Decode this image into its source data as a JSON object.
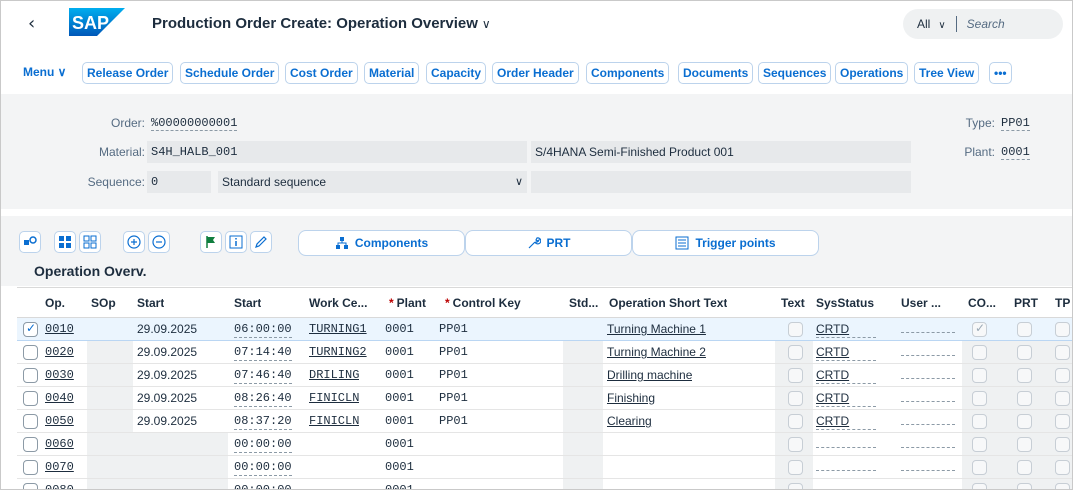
{
  "shell": {
    "back_glyph": "‹",
    "logo_text": "SAP",
    "title": "Production Order Create: Operation Overview",
    "title_chevron": "∨",
    "search_scope": "All",
    "search_scope_chevron": "∨",
    "search_placeholder": "Search"
  },
  "toolbar": {
    "menu": "Menu ∨",
    "items": [
      "Release Order",
      "Schedule Order",
      "Cost Order",
      "Material",
      "Capacity",
      "Order Header",
      "Components",
      "Documents",
      "Sequences",
      "Operations",
      "Tree View"
    ],
    "more": "•••"
  },
  "header": {
    "order_label": "Order:",
    "order_value": "%00000000001",
    "type_label": "Type:",
    "type_value": "PP01",
    "material_label": "Material:",
    "material_value": "S4H_HALB_001",
    "material_desc": "S/4HANA Semi-Finished Product 001",
    "plant_label": "Plant:",
    "plant_value": "0001",
    "sequence_label": "Sequence:",
    "sequence_value": "0",
    "sequence_desc": "Standard sequence",
    "sequence_chevron": "∨"
  },
  "grid_toolbar": {
    "components": "Components",
    "prt": "PRT",
    "trigger_points": "Trigger points"
  },
  "section_title": "Operation Overv.",
  "table": {
    "columns": {
      "op": "Op.",
      "sop": "SOp",
      "start_date": "Start",
      "start_time": "Start",
      "work_center": "Work Ce...",
      "plant": "Plant",
      "control_key": "Control Key",
      "std": "Std...",
      "short_text": "Operation Short Text",
      "text": "Text",
      "sys_status": "SysStatus",
      "user": "User ...",
      "co": "CO...",
      "prt": "PRT",
      "tp": "TP"
    },
    "required_marker": "*",
    "rows": [
      {
        "op": "0010",
        "date": "29.09.2025",
        "time": "06:00:00",
        "wc": "TURNING1",
        "plant": "0001",
        "ck": "PP01",
        "text": "Turning Machine 1",
        "status": "CRTD",
        "co": true
      },
      {
        "op": "0020",
        "date": "29.09.2025",
        "time": "07:14:40",
        "wc": "TURNING2",
        "plant": "0001",
        "ck": "PP01",
        "text": "Turning Machine 2",
        "status": "CRTD",
        "co": false
      },
      {
        "op": "0030",
        "date": "29.09.2025",
        "time": "07:46:40",
        "wc": "DRILING",
        "plant": "0001",
        "ck": "PP01",
        "text": "Drilling machine",
        "status": "CRTD",
        "co": false
      },
      {
        "op": "0040",
        "date": "29.09.2025",
        "time": "08:26:40",
        "wc": "FINICLN",
        "plant": "0001",
        "ck": "PP01",
        "text": "Finishing",
        "status": "CRTD",
        "co": false
      },
      {
        "op": "0050",
        "date": "29.09.2025",
        "time": "08:37:20",
        "wc": "FINICLN",
        "plant": "0001",
        "ck": "PP01",
        "text": "Clearing",
        "status": "CRTD",
        "co": false
      },
      {
        "op": "0060",
        "date": "",
        "time": "00:00:00",
        "wc": "",
        "plant": "0001",
        "ck": "",
        "text": "",
        "status": "",
        "co": false
      },
      {
        "op": "0070",
        "date": "",
        "time": "00:00:00",
        "wc": "",
        "plant": "0001",
        "ck": "",
        "text": "",
        "status": "",
        "co": false
      },
      {
        "op": "0080",
        "date": "",
        "time": "00:00:00",
        "wc": "",
        "plant": "0001",
        "ck": "",
        "text": "",
        "status": "",
        "co": false
      }
    ]
  },
  "colors": {
    "accent": "#0a6ed1",
    "selected_row": "#ebf5fe",
    "required": "#bb0000"
  }
}
